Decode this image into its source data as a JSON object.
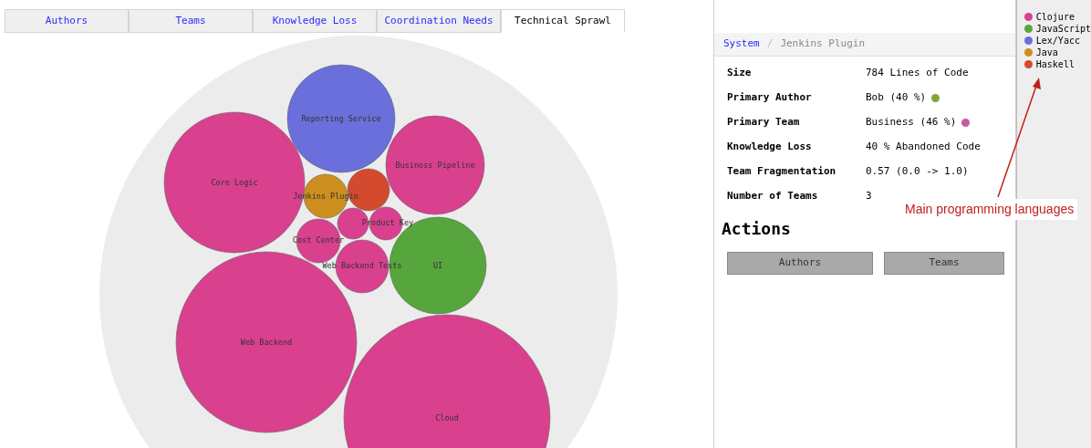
{
  "tabs": [
    {
      "label": "Authors",
      "selected": false
    },
    {
      "label": "Teams",
      "selected": false
    },
    {
      "label": "Knowledge Loss",
      "selected": false
    },
    {
      "label": "Coordination Needs",
      "selected": false
    },
    {
      "label": "Technical Sprawl",
      "selected": true
    }
  ],
  "bubbles": [
    {
      "label": "Reporting Service",
      "color": "#6a6fdb"
    },
    {
      "label": "Core Logic",
      "color": "#d9408e"
    },
    {
      "label": "Business Pipeline",
      "color": "#d9408e"
    },
    {
      "label": "Jenkins Plugin",
      "color": "#cc8e1e"
    },
    {
      "color": "#d44a2e"
    },
    {
      "color": "#d9408e"
    },
    {
      "label": "Product Key",
      "color": "#d9408e"
    },
    {
      "label": "Cost Center",
      "color": "#d9408e"
    },
    {
      "label": "Web Backend Tests",
      "color": "#d9408e"
    },
    {
      "label": "UI",
      "color": "#56a63d"
    },
    {
      "label": "Web Backend",
      "color": "#d9408e"
    },
    {
      "label": "Cloud",
      "color": "#d9408e"
    }
  ],
  "breadcrumb": {
    "root": "System",
    "separator": "/",
    "current": "Jenkins Plugin"
  },
  "details": [
    {
      "label": "Size",
      "value": "784 Lines of Code"
    },
    {
      "label": "Primary Author",
      "value": "Bob (40 %)",
      "color": "#84a33a"
    },
    {
      "label": "Primary Team",
      "value": "Business (46 %)",
      "color": "#c857a4"
    },
    {
      "label": "Knowledge Loss",
      "value": "40 % Abandoned Code"
    },
    {
      "label": "Team Fragmentation",
      "value": "0.57 (0.0 -> 1.0)"
    },
    {
      "label": "Number of Teams",
      "value": "3"
    }
  ],
  "actions": {
    "title": "Actions",
    "buttons": [
      "Authors",
      "Teams"
    ]
  },
  "legend": [
    {
      "label": "Clojure",
      "color": "#d9408e"
    },
    {
      "label": "JavaScript",
      "color": "#56a63d"
    },
    {
      "label": "Lex/Yacc",
      "color": "#6a6fdb"
    },
    {
      "label": "Java",
      "color": "#cc8e1e"
    },
    {
      "label": "Haskell",
      "color": "#d44a2e"
    }
  ],
  "annotation": "Main programming languages"
}
